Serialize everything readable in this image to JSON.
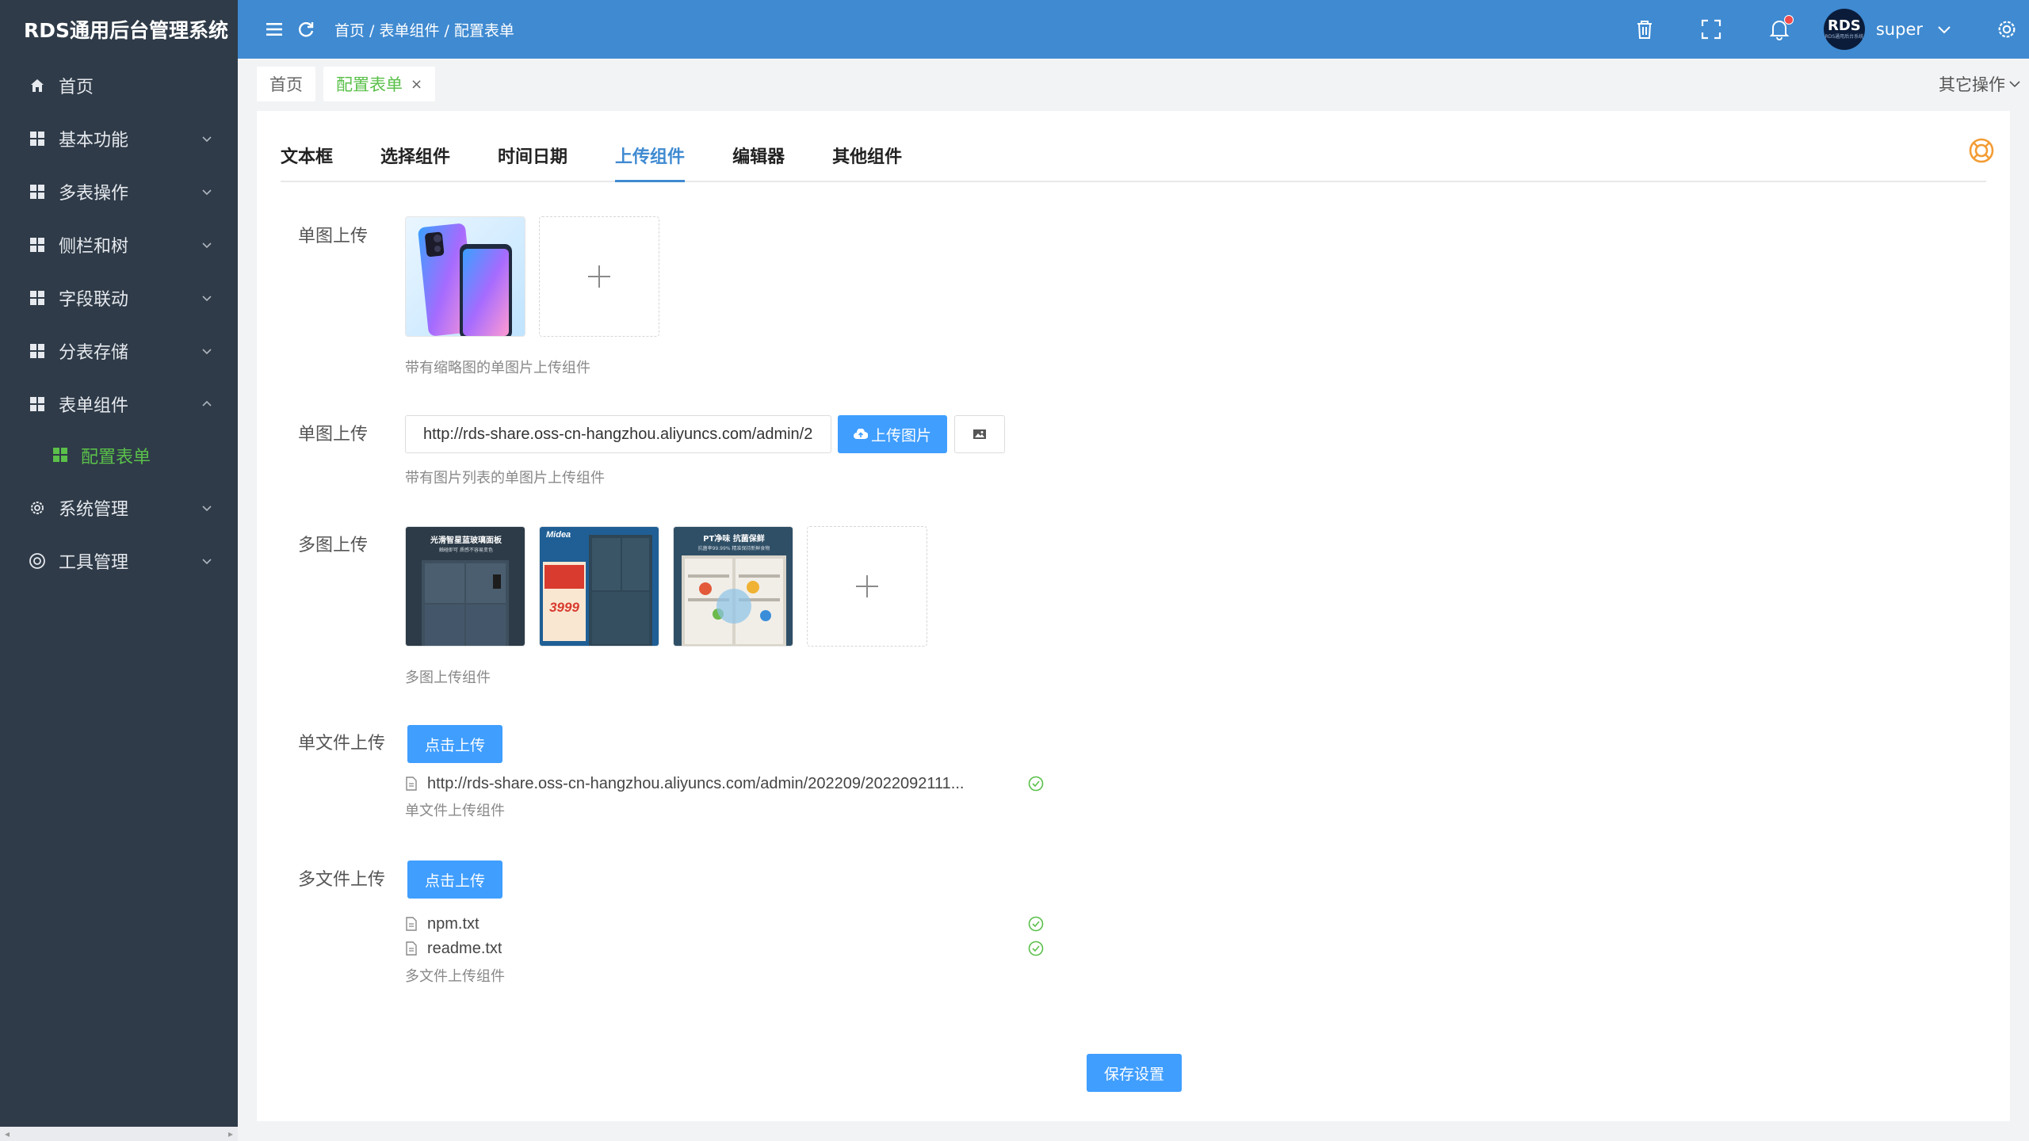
{
  "app": {
    "title": "RDS通用后台管理系统"
  },
  "sidebar": {
    "items": [
      {
        "label": "首页",
        "icon": "home-icon"
      },
      {
        "label": "基本功能",
        "icon": "grid-icon"
      },
      {
        "label": "多表操作",
        "icon": "grid-icon"
      },
      {
        "label": "侧栏和树",
        "icon": "grid-icon"
      },
      {
        "label": "字段联动",
        "icon": "grid-icon"
      },
      {
        "label": "分表存储",
        "icon": "grid-icon"
      },
      {
        "label": "表单组件",
        "icon": "grid-icon"
      },
      {
        "label": "系统管理",
        "icon": "gear-icon"
      },
      {
        "label": "工具管理",
        "icon": "lifebuoy-icon"
      }
    ],
    "submenu": {
      "label": "配置表单"
    }
  },
  "header": {
    "breadcrumb": [
      "首页",
      "/ 表单组件",
      "/ 配置表单"
    ],
    "username": "super",
    "avatar_text": "RDS",
    "avatar_subtext": "RDS通用后台系统"
  },
  "tabs": {
    "home": "首页",
    "current": "配置表单",
    "close": "×",
    "other_ops": "其它操作"
  },
  "component_tabs": [
    "文本框",
    "选择组件",
    "时间日期",
    "上传组件",
    "编辑器",
    "其他组件"
  ],
  "active_tab": "上传组件",
  "form": {
    "single_image": {
      "label": "单图上传",
      "hint": "带有缩略图的单图片上传组件"
    },
    "single_image_url": {
      "label": "单图上传",
      "value": "http://rds-share.oss-cn-hangzhou.aliyuncs.com/admin/2",
      "button": "上传图片",
      "hint": "带有图片列表的单图片上传组件"
    },
    "multi_image": {
      "label": "多图上传",
      "hint": "多图上传组件",
      "images": [
        {
          "caption": "光滑智星蓝玻璃面板",
          "subcaption": "触碰即可 质感不容易变色"
        },
        {
          "brand": "Midea",
          "price": "3999"
        },
        {
          "caption": "PT净味 抗菌保鲜",
          "subcaption": "抗菌率99.99% 精准保持新鲜食物"
        }
      ]
    },
    "single_file": {
      "label": "单文件上传",
      "button": "点击上传",
      "files": [
        "http://rds-share.oss-cn-hangzhou.aliyuncs.com/admin/202209/2022092111..."
      ],
      "hint": "单文件上传组件"
    },
    "multi_file": {
      "label": "多文件上传",
      "button": "点击上传",
      "files": [
        "npm.txt",
        "readme.txt"
      ],
      "hint": "多文件上传组件"
    },
    "save": "保存设置"
  },
  "colors": {
    "sidebar_bg": "#2f3b48",
    "header_bg": "#3f8ad1",
    "accent_green": "#5ac04a",
    "primary_blue": "#409eff",
    "success_green": "#5ac04a",
    "notify_red": "#f24b4b"
  }
}
